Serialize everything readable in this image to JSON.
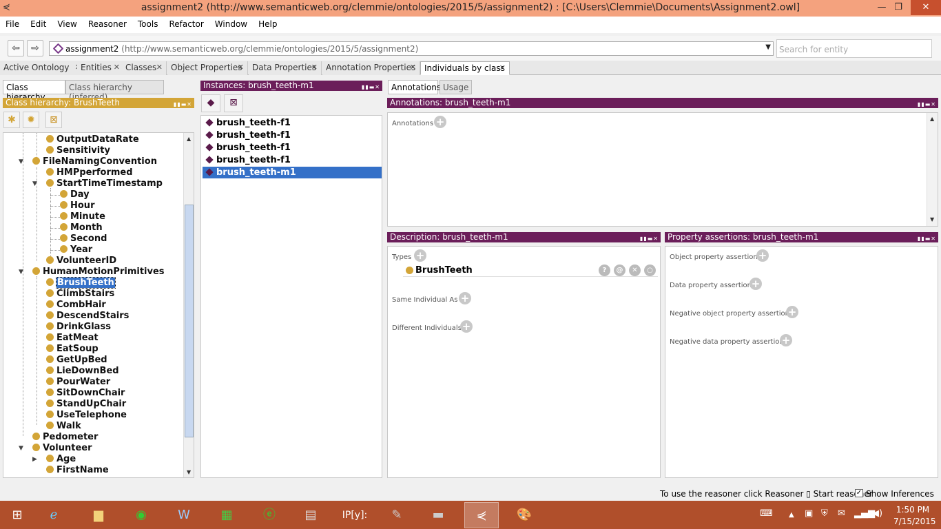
{
  "window": {
    "title": "assignment2 (http://www.semanticweb.org/clemmie/ontologies/2015/5/assignment2)  : [C:\\Users\\Clemmie\\Documents\\Assignment2.owl]"
  },
  "menu": [
    "File",
    "Edit",
    "View",
    "Reasoner",
    "Tools",
    "Refactor",
    "Window",
    "Help"
  ],
  "address": {
    "name": "assignment2",
    "iri": "(http://www.semanticweb.org/clemmie/ontologies/2015/5/assignment2)",
    "search_placeholder": "Search for entity"
  },
  "tabs": [
    "Active Ontology",
    "Entities",
    "Classes",
    "Object Properties",
    "Data Properties",
    "Annotation Properties",
    "Individuals by class"
  ],
  "left": {
    "subtabs": [
      "Class hierarchy",
      "Class hierarchy (inferred)"
    ],
    "header": "Class hierarchy: BrushTeeth",
    "tree": [
      "OutputDataRate",
      "Sensitivity",
      "FileNamingConvention",
      "HMPperformed",
      "StartTimeTimestamp",
      "Day",
      "Hour",
      "Minute",
      "Month",
      "Second",
      "Year",
      "VolunteerID",
      "HumanMotionPrimitives",
      "BrushTeeth",
      "ClimbStairs",
      "CombHair",
      "DescendStairs",
      "DrinkGlass",
      "EatMeat",
      "EatSoup",
      "GetUpBed",
      "LieDownBed",
      "PourWater",
      "SitDownChair",
      "StandUpChair",
      "UseTelephone",
      "Walk",
      "Pedometer",
      "Volunteer",
      "Age",
      "FirstName"
    ]
  },
  "instances": {
    "header": "Instances: brush_teeth-m1",
    "items": [
      "brush_teeth-f1",
      "brush_teeth-f1",
      "brush_teeth-f1",
      "brush_teeth-f1",
      "brush_teeth-m1"
    ]
  },
  "right": {
    "subtabs": [
      "Annotations",
      "Usage"
    ],
    "annotations_header": "Annotations: brush_teeth-m1",
    "annotations_label": "Annotations",
    "description_header": "Description: brush_teeth-m1",
    "types_label": "Types",
    "type_value": "BrushTeeth",
    "same_label": "Same Individual As",
    "different_label": "Different Individuals",
    "assertions_header": "Property assertions: brush_teeth-m1",
    "object_assert": "Object property assertions",
    "data_assert": "Data property assertions",
    "neg_object_assert": "Negative object property assertions",
    "neg_data_assert": "Negative data property assertions"
  },
  "status": {
    "text": "To use the reasoner click Reasoner ▯ Start reasoner",
    "show_inferences": "Show Inferences"
  },
  "clock": {
    "time": "1:50 PM",
    "date": "7/15/2015"
  }
}
